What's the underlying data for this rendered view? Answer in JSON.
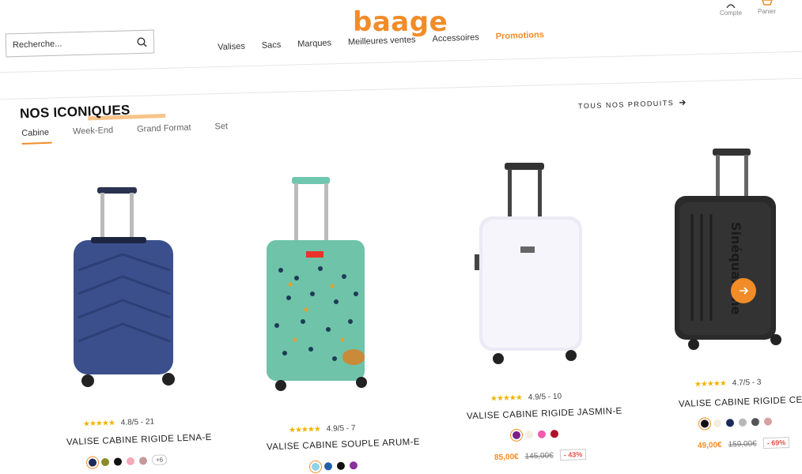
{
  "header": {
    "logo": "baage",
    "account_label": "Compte",
    "cart_label": "Panier",
    "search_placeholder": "Recherche..."
  },
  "nav": [
    "Valises",
    "Sacs",
    "Marques",
    "Meilleures ventes",
    "Accessoires",
    "Promotions"
  ],
  "section": {
    "title_part1": "NOS ",
    "title_part2": "ICONIQUES",
    "all_products": "TOUS NOS PRODUITS",
    "tabs": [
      "Cabine",
      "Week-End",
      "Grand Format",
      "Set"
    ]
  },
  "products": [
    {
      "rating": "4.8/5 - 21",
      "name": "VALISE CABINE RIGIDE LENA-E",
      "colors": [
        "#1c2a5a",
        "#8a8a2a",
        "#111111",
        "#f4a8b8",
        "#c49a9a"
      ],
      "more": "+6"
    },
    {
      "rating": "4.9/5 - 7",
      "name": "VALISE CABINE SOUPLE ARUM-E",
      "colors": [
        "#8fd3ea",
        "#1f5fb0",
        "#111111",
        "#8a2f9a"
      ]
    },
    {
      "rating": "4.9/5 - 10",
      "name": "VALISE CABINE RIGIDE JASMIN-E",
      "colors": [
        "#7a1f8a",
        "#f2efe0",
        "#f25bb0",
        "#b0102a"
      ],
      "price": "85,00€",
      "old_price": "145,00€",
      "discount": "- 43%"
    },
    {
      "rating": "4.7/5 - 3",
      "name": "VALISE CABINE RIGIDE CERE",
      "colors": [
        "#111111",
        "#f2efe0",
        "#1c2a5a",
        "#b8b8b8",
        "#555555",
        "#d8a0a0"
      ],
      "price": "49,00€",
      "old_price": "159,00€",
      "discount": "- 69%"
    }
  ],
  "colors": {
    "accent": "#f28c28"
  },
  "icons": [
    "account-icon",
    "cart-icon",
    "search-icon",
    "arrow-right-icon",
    "carousel-next-icon"
  ]
}
